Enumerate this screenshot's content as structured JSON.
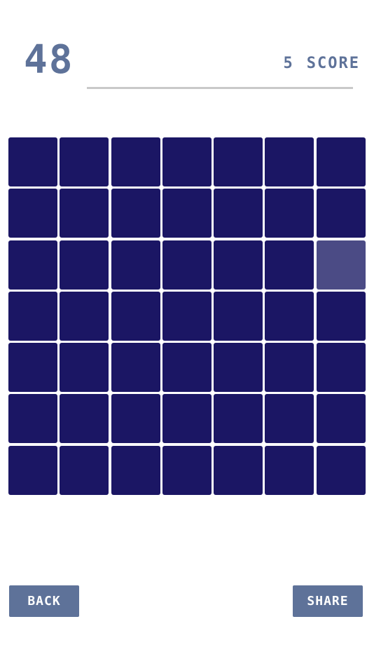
{
  "header": {
    "timer_value": "48",
    "score_value": "5",
    "score_label": "SCORE"
  },
  "grid": {
    "rows": 7,
    "cols": 7,
    "odd_cell": {
      "row": 2,
      "col": 6
    },
    "colors": {
      "cell": "#1b1664",
      "odd_cell": "#4b4b85"
    }
  },
  "buttons": {
    "back_label": "BACK",
    "share_label": "SHARE"
  },
  "colors": {
    "accent": "#5e7299",
    "divider": "#c9c9c9",
    "background": "#ffffff"
  }
}
